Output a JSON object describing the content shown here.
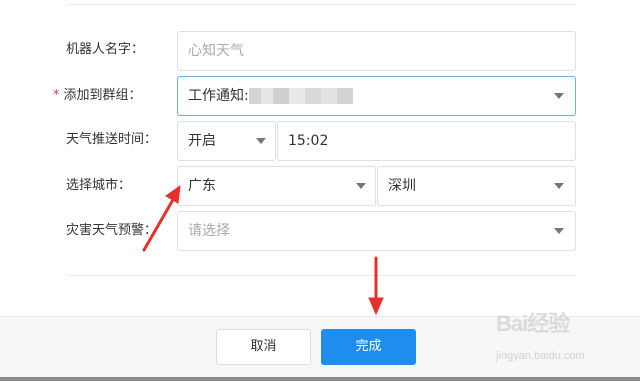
{
  "form": {
    "robot_name": {
      "label": "机器人名字：",
      "placeholder": "心知天气"
    },
    "group": {
      "required_mark": "*",
      "label": "添加到群组：",
      "value": "工作通知:"
    },
    "push_time": {
      "label": "天气推送时间：",
      "switch_value": "开启",
      "time_value": "15:02"
    },
    "city": {
      "label": "选择城市：",
      "province": "广东",
      "city": "深圳"
    },
    "disaster_warning": {
      "label": "灾害天气预警：",
      "placeholder": "请选择"
    }
  },
  "footer": {
    "cancel_label": "取消",
    "done_label": "完成"
  },
  "watermark": {
    "logo_text": "Bai经验",
    "sub_text": "jingyan.baidu.com"
  },
  "colors": {
    "primary": "#1f8ded",
    "required": "#e4393c",
    "annotation_arrow": "#e8302a"
  },
  "icons": [
    "caret-down-icon",
    "annotation-arrow"
  ]
}
